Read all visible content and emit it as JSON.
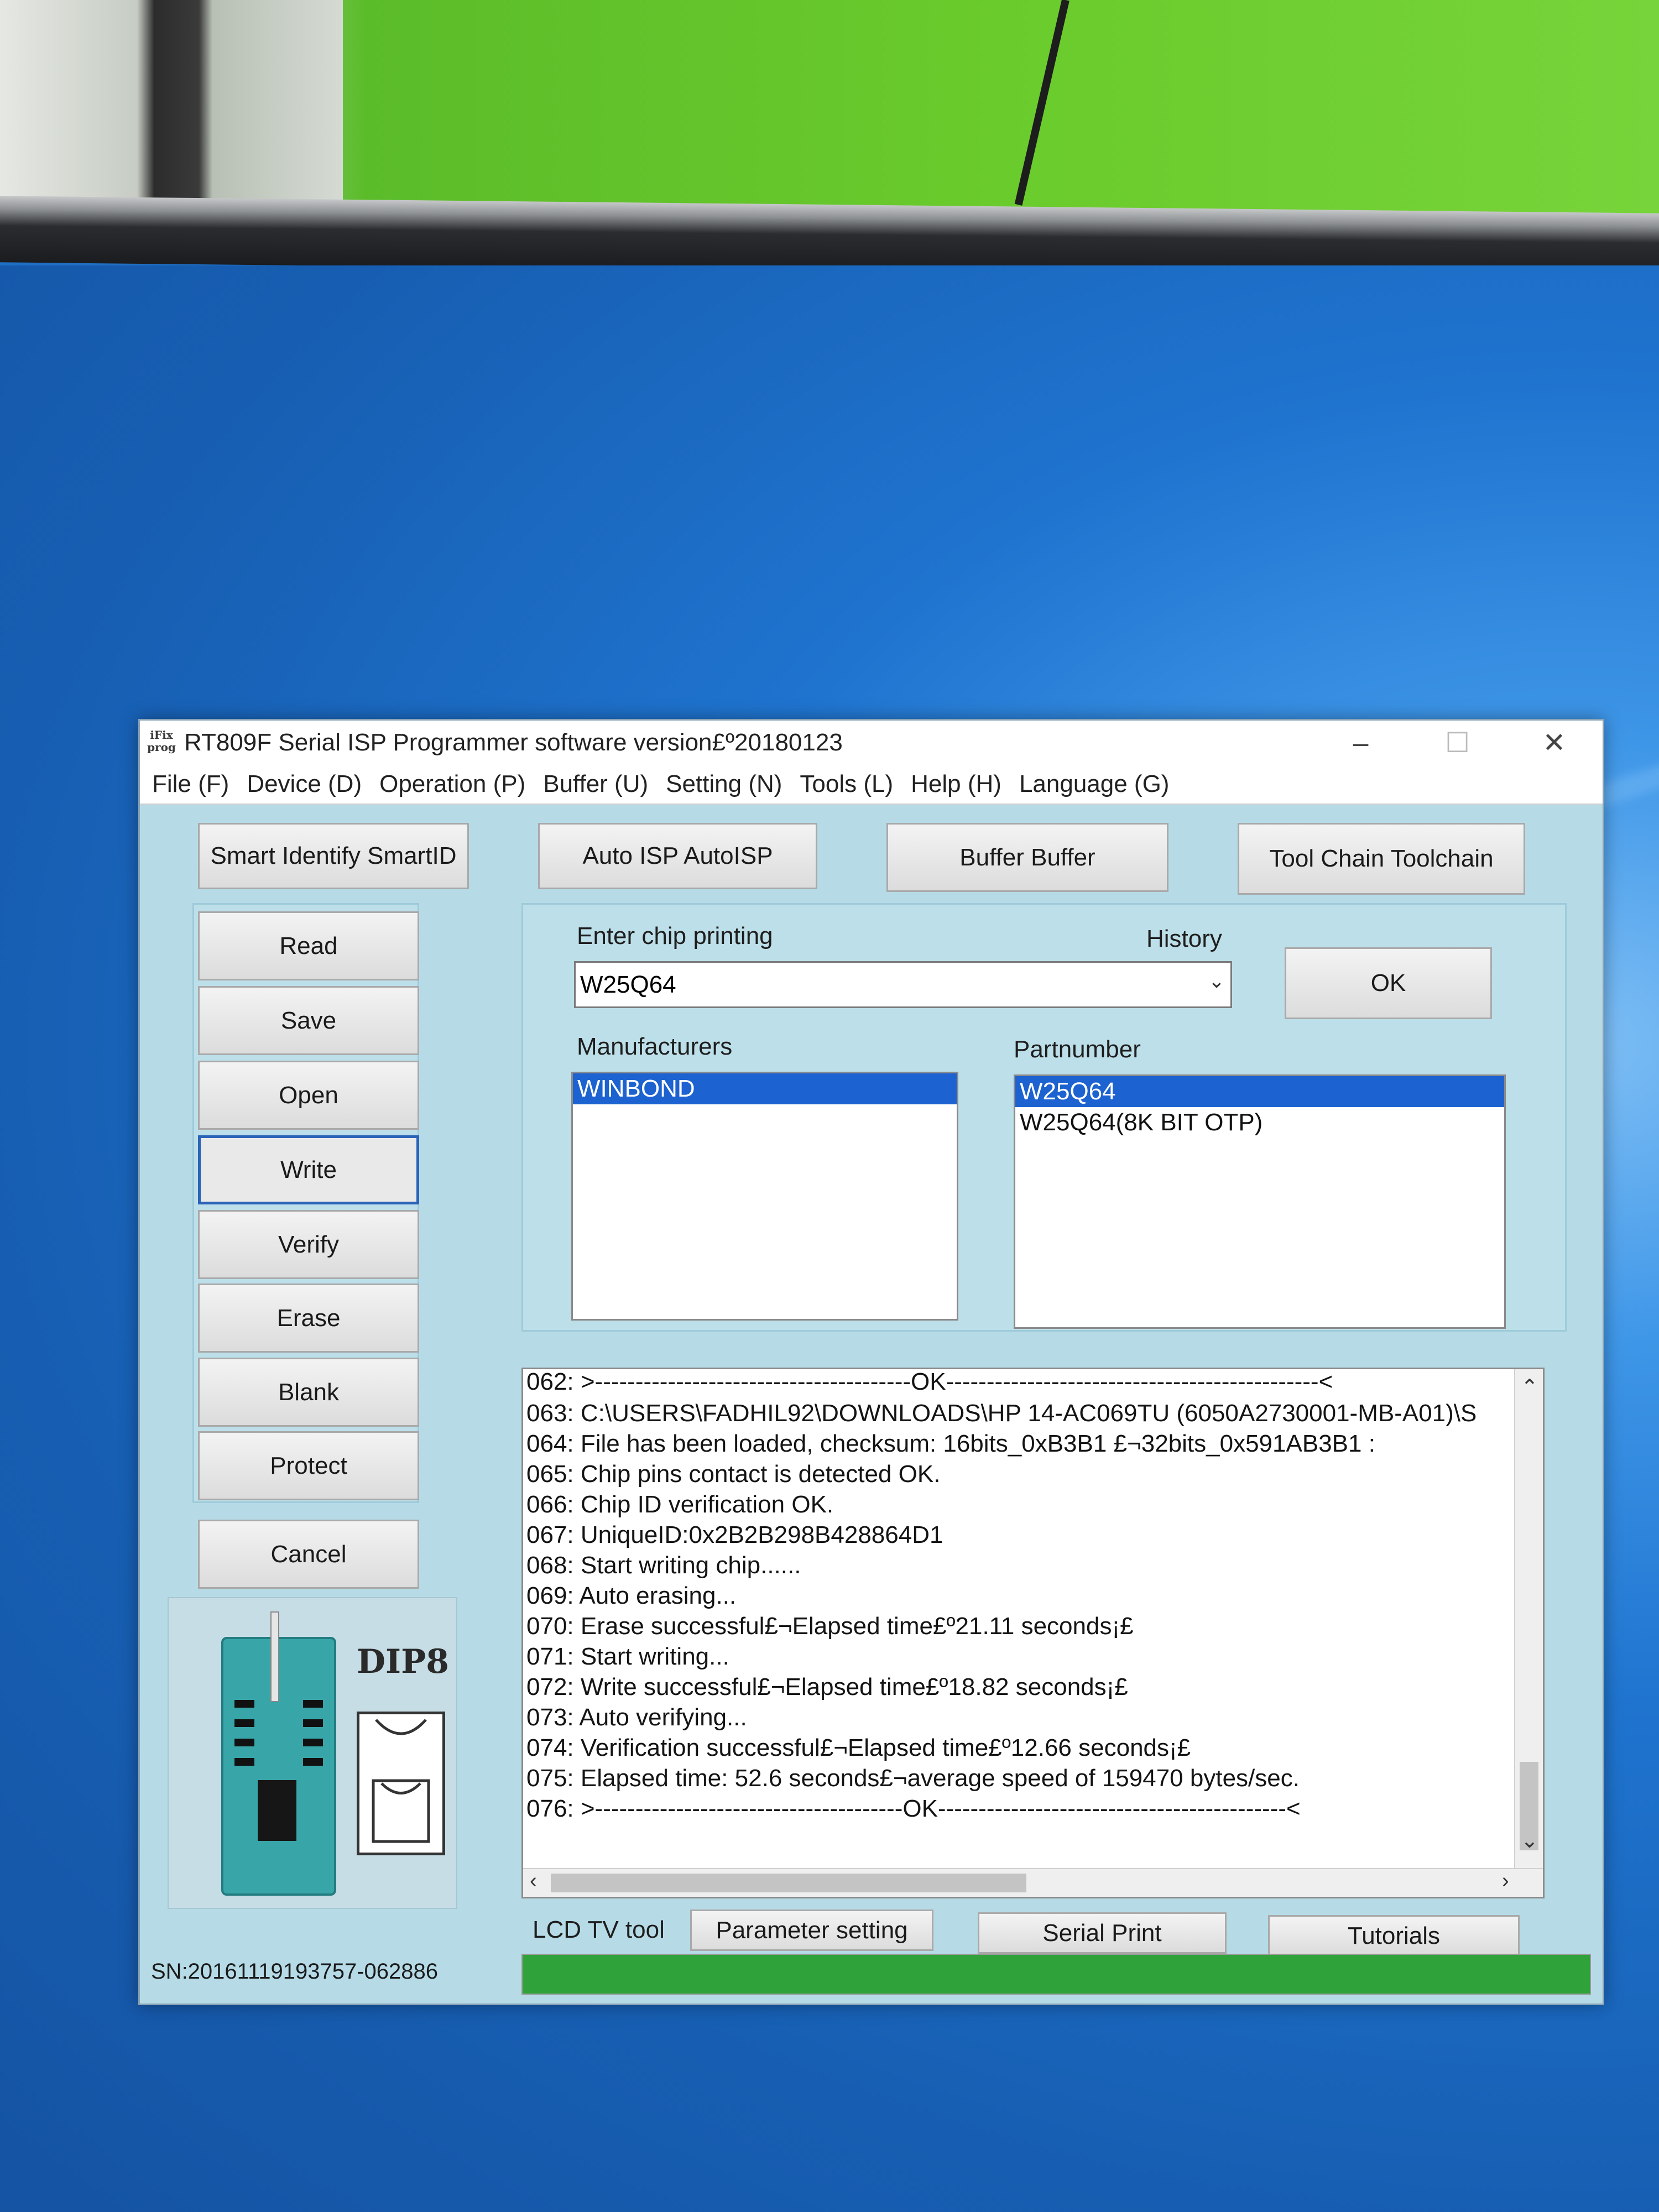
{
  "window": {
    "title": "RT809F Serial ISP Programmer software version£º20180123",
    "app_icon_text": "iFix prog",
    "controls": [
      "–",
      "☐",
      "✕"
    ]
  },
  "menu": [
    "File (F)",
    "Device (D)",
    "Operation (P)",
    "Buffer (U)",
    "Setting (N)",
    "Tools (L)",
    "Help (H)",
    "Language (G)"
  ],
  "toolbar": {
    "smart_id": "Smart Identify SmartID",
    "auto_isp": "Auto ISP AutoISP",
    "buffer": "Buffer Buffer",
    "toolchain": "Tool Chain Toolchain"
  },
  "actions": {
    "read": "Read",
    "save": "Save",
    "open": "Open",
    "write": "Write",
    "verify": "Verify",
    "erase": "Erase",
    "blank": "Blank",
    "protect": "Protect",
    "cancel": "Cancel"
  },
  "chip": {
    "enter_label": "Enter chip printing",
    "history_label": "History",
    "value": "W25Q64",
    "ok": "OK",
    "manufacturers_label": "Manufacturers",
    "manufacturers": [
      "WINBOND"
    ],
    "partnumber_label": "Partnumber",
    "partnumbers": [
      "W25Q64",
      "W25Q64(8K BIT OTP)"
    ]
  },
  "log": [
    "062:  >---------------------------------------OK----------------------------------------------<",
    "063:  C:\\USERS\\FADHIL92\\DOWNLOADS\\HP 14-AC069TU (6050A2730001-MB-A01)\\S",
    "064:  File has been loaded, checksum: 16bits_0xB3B1 £¬32bits_0x591AB3B1 :",
    "065:  Chip pins contact is detected OK.",
    "066:  Chip ID verification OK.",
    "067:  UniqueID:0x2B2B298B428864D1",
    "068:  Start writing chip......",
    "069:  Auto erasing...",
    "070:  Erase successful£¬Elapsed time£º21.11 seconds¡£",
    "071:  Start writing...",
    "072:  Write successful£¬Elapsed time£º18.82 seconds¡£",
    "073:  Auto verifying...",
    "074:  Verification successful£¬Elapsed time£º12.66 seconds¡£",
    "075:  Elapsed time: 52.6 seconds£¬average speed of 159470 bytes/sec.",
    "076:  >--------------------------------------OK-------------------------------------------<"
  ],
  "bottom": {
    "lcd": "LCD TV tool",
    "param": "Parameter setting",
    "serial": "Serial Print",
    "tutorials": "Tutorials"
  },
  "status": {
    "sn": "SN:20161119193757-062886",
    "progress": 1.0
  },
  "adapter": {
    "label": "DIP8"
  }
}
